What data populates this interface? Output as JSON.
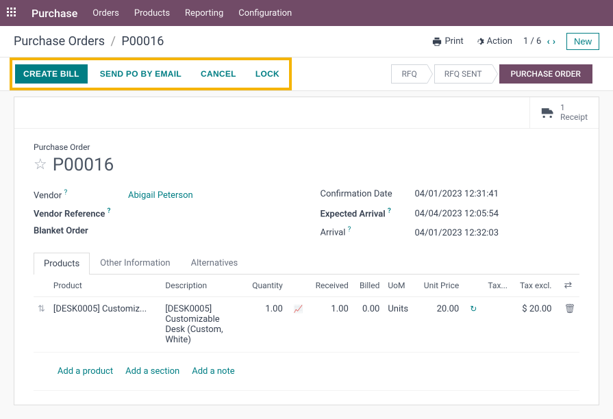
{
  "topnav": {
    "brand": "Purchase",
    "menu": [
      "Orders",
      "Products",
      "Reporting",
      "Configuration"
    ]
  },
  "breadcrumb": {
    "parent": "Purchase Orders",
    "current": "P00016"
  },
  "controls": {
    "print": "Print",
    "action": "Action",
    "pager": "1 / 6",
    "new": "New"
  },
  "buttons": {
    "create_bill": "CREATE BILL",
    "send_po": "SEND PO BY EMAIL",
    "cancel": "CANCEL",
    "lock": "LOCK"
  },
  "status": {
    "rfq": "RFQ",
    "rfq_sent": "RFQ SENT",
    "po": "PURCHASE ORDER"
  },
  "stat": {
    "count": "1",
    "label": "Receipt"
  },
  "form": {
    "title_label": "Purchase Order",
    "title": "P00016",
    "vendor_label": "Vendor",
    "vendor": "Abigail Peterson",
    "vendor_ref_label": "Vendor Reference",
    "vendor_ref": "",
    "blanket_label": "Blanket Order",
    "blanket": "",
    "conf_date_label": "Confirmation Date",
    "conf_date": "04/01/2023 12:31:41",
    "exp_arrival_label": "Expected Arrival",
    "exp_arrival": "04/04/2023 12:05:54",
    "arrival_label": "Arrival",
    "arrival": "04/01/2023 12:32:03"
  },
  "tabs": {
    "products": "Products",
    "other": "Other Information",
    "alt": "Alternatives"
  },
  "table": {
    "headers": {
      "product": "Product",
      "description": "Description",
      "quantity": "Quantity",
      "received": "Received",
      "billed": "Billed",
      "uom": "UoM",
      "unit_price": "Unit Price",
      "tax": "Tax...",
      "tax_excl": "Tax excl."
    },
    "rows": [
      {
        "product": "[DESK0005] Customiz...",
        "description": "[DESK0005] Customizable Desk (Custom, White)",
        "quantity": "1.00",
        "received": "1.00",
        "billed": "0.00",
        "uom": "Units",
        "unit_price": "20.00",
        "tax": "",
        "tax_excl": "$ 20.00"
      }
    ],
    "add_product": "Add a product",
    "add_section": "Add a section",
    "add_note": "Add a note"
  }
}
